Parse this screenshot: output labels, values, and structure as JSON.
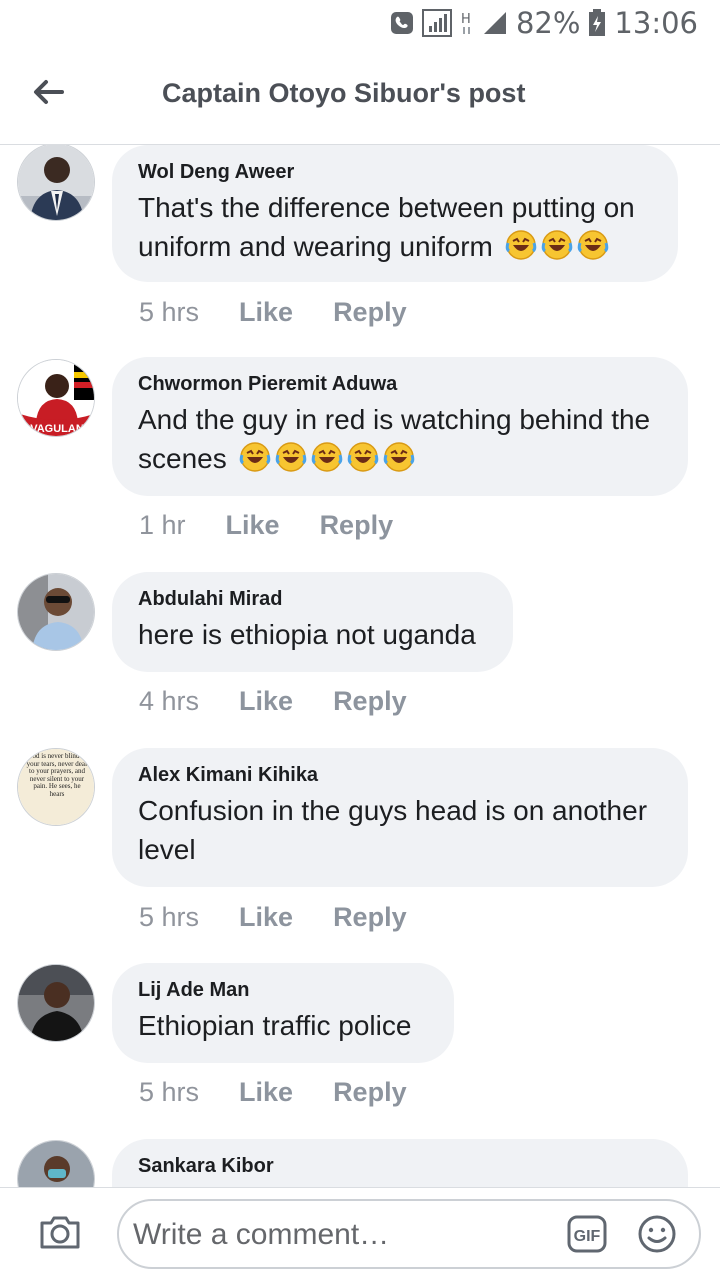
{
  "status_bar": {
    "battery": "82%",
    "time": "13:06"
  },
  "header": {
    "title": "Captain Otoyo Sibuor's post"
  },
  "comments": [
    {
      "author": "Wol Deng Aweer",
      "text": "That's the difference between putting on uniform and wearing uniform",
      "emoji_count": 3,
      "time": "5 hrs"
    },
    {
      "author": "Chwormon Pieremit Aduwa",
      "text": "And the guy in red is watching behind the scenes",
      "emoji_count": 5,
      "time": "1 hr"
    },
    {
      "author": "Abdulahi Mirad",
      "text": "here is ethiopia not uganda",
      "emoji_count": 0,
      "time": "4 hrs"
    },
    {
      "author": "Alex Kimani Kihika",
      "text": "Confusion in the guys head is on another level",
      "emoji_count": 0,
      "time": "5 hrs"
    },
    {
      "author": "Lij Ade Man",
      "text": "Ethiopian traffic police",
      "emoji_count": 0,
      "time": "5 hrs"
    },
    {
      "author": "Sankara Kibor",
      "text": "",
      "emoji_count": 0,
      "time": ""
    }
  ],
  "actions": {
    "like": "Like",
    "reply": "Reply"
  },
  "avatar_texts": {
    "vagulani": "VAGULAN",
    "quote": "God is never blind to your tears, never deaf to your prayers, and never silent to your pain. He sees, he hears"
  },
  "composer": {
    "placeholder": "Write a comment…",
    "gif_label": "GIF"
  },
  "icons": [
    "phone-icon",
    "signal-icon",
    "h-plus-icon",
    "battery-icon",
    "back-arrow-icon",
    "laughing-emoji-icon",
    "camera-icon",
    "gif-icon",
    "smiley-icon"
  ],
  "colors": {
    "bubble": "#f0f2f5",
    "meta": "#90949c",
    "title": "#4b4f56"
  }
}
